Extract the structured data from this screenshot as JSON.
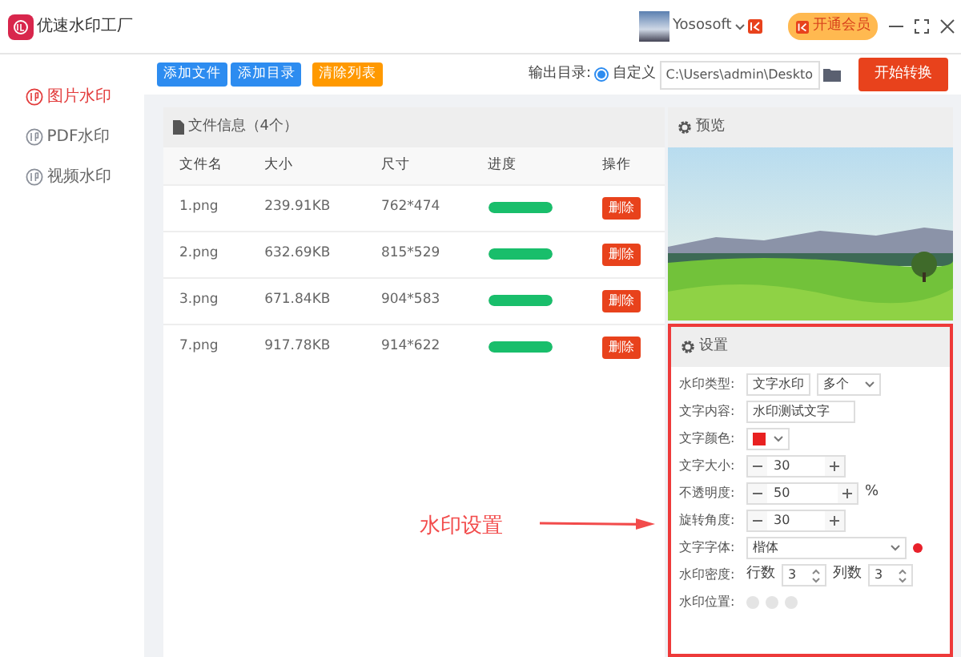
{
  "window": {
    "app_name": "优速水印工厂",
    "user": "Yososoft",
    "vip_button": "开通会员"
  },
  "sidebar": {
    "items": [
      {
        "label": "图片水印",
        "selected": true
      },
      {
        "label": "PDF水印",
        "selected": false
      },
      {
        "label": "视频水印",
        "selected": false
      }
    ]
  },
  "toolbar": {
    "buttons": [
      {
        "label": "添加文件",
        "kind": "primary"
      },
      {
        "label": "添加目录",
        "kind": "primary"
      },
      {
        "label": "清除列表",
        "kind": "warning"
      }
    ],
    "output_label": "输出目录:",
    "output_option": {
      "label": "自定义",
      "selected": true
    },
    "output_path": "C:\\Users\\admin\\Deskto",
    "start_button": "开始转换"
  },
  "file_panel": {
    "title": "文件信息（4个）",
    "columns": [
      "文件名",
      "大小",
      "尺寸",
      "进度",
      "操作"
    ],
    "rows": [
      {
        "name": "1.png",
        "size": "239.91KB",
        "dimensions": "762*474",
        "level": 1,
        "action": "删除"
      },
      {
        "name": "2.png",
        "size": "632.69KB",
        "dimensions": "815*529",
        "level": 1,
        "action": "删除"
      },
      {
        "name": "3.png",
        "size": "671.84KB",
        "dimensions": "904*583",
        "level": 1,
        "action": "删除"
      },
      {
        "name": "7.png",
        "size": "917.78KB",
        "dimensions": "914*622",
        "level": 1,
        "action": "删除"
      }
    ]
  },
  "preview": {
    "title": "预览"
  },
  "settings": {
    "title": "设置",
    "fields": [
      {
        "kind": "select2",
        "label": "水印类型:",
        "value": "文字水印",
        "value_2": "多个"
      },
      {
        "kind": "text",
        "label": "文字内容:",
        "value": "水印测试文字"
      },
      {
        "kind": "color",
        "label": "文字颜色:",
        "color": "#e82020"
      },
      {
        "kind": "stepper",
        "label": "文字大小:",
        "value": "30"
      },
      {
        "kind": "stepper",
        "label": "不透明度:",
        "value": "50",
        "unit": "%"
      },
      {
        "kind": "stepper",
        "label": "旋转角度:",
        "value": "30"
      },
      {
        "kind": "select",
        "label": "文字字体:",
        "value": "楷体"
      },
      {
        "kind": "density",
        "label": "水印密度:",
        "rows_label": "行数",
        "rows": "3",
        "cols_label": "列数",
        "cols": "3"
      },
      {
        "kind": "position",
        "label": "水印位置:"
      }
    ]
  },
  "annotation": {
    "text": "水印设置"
  }
}
